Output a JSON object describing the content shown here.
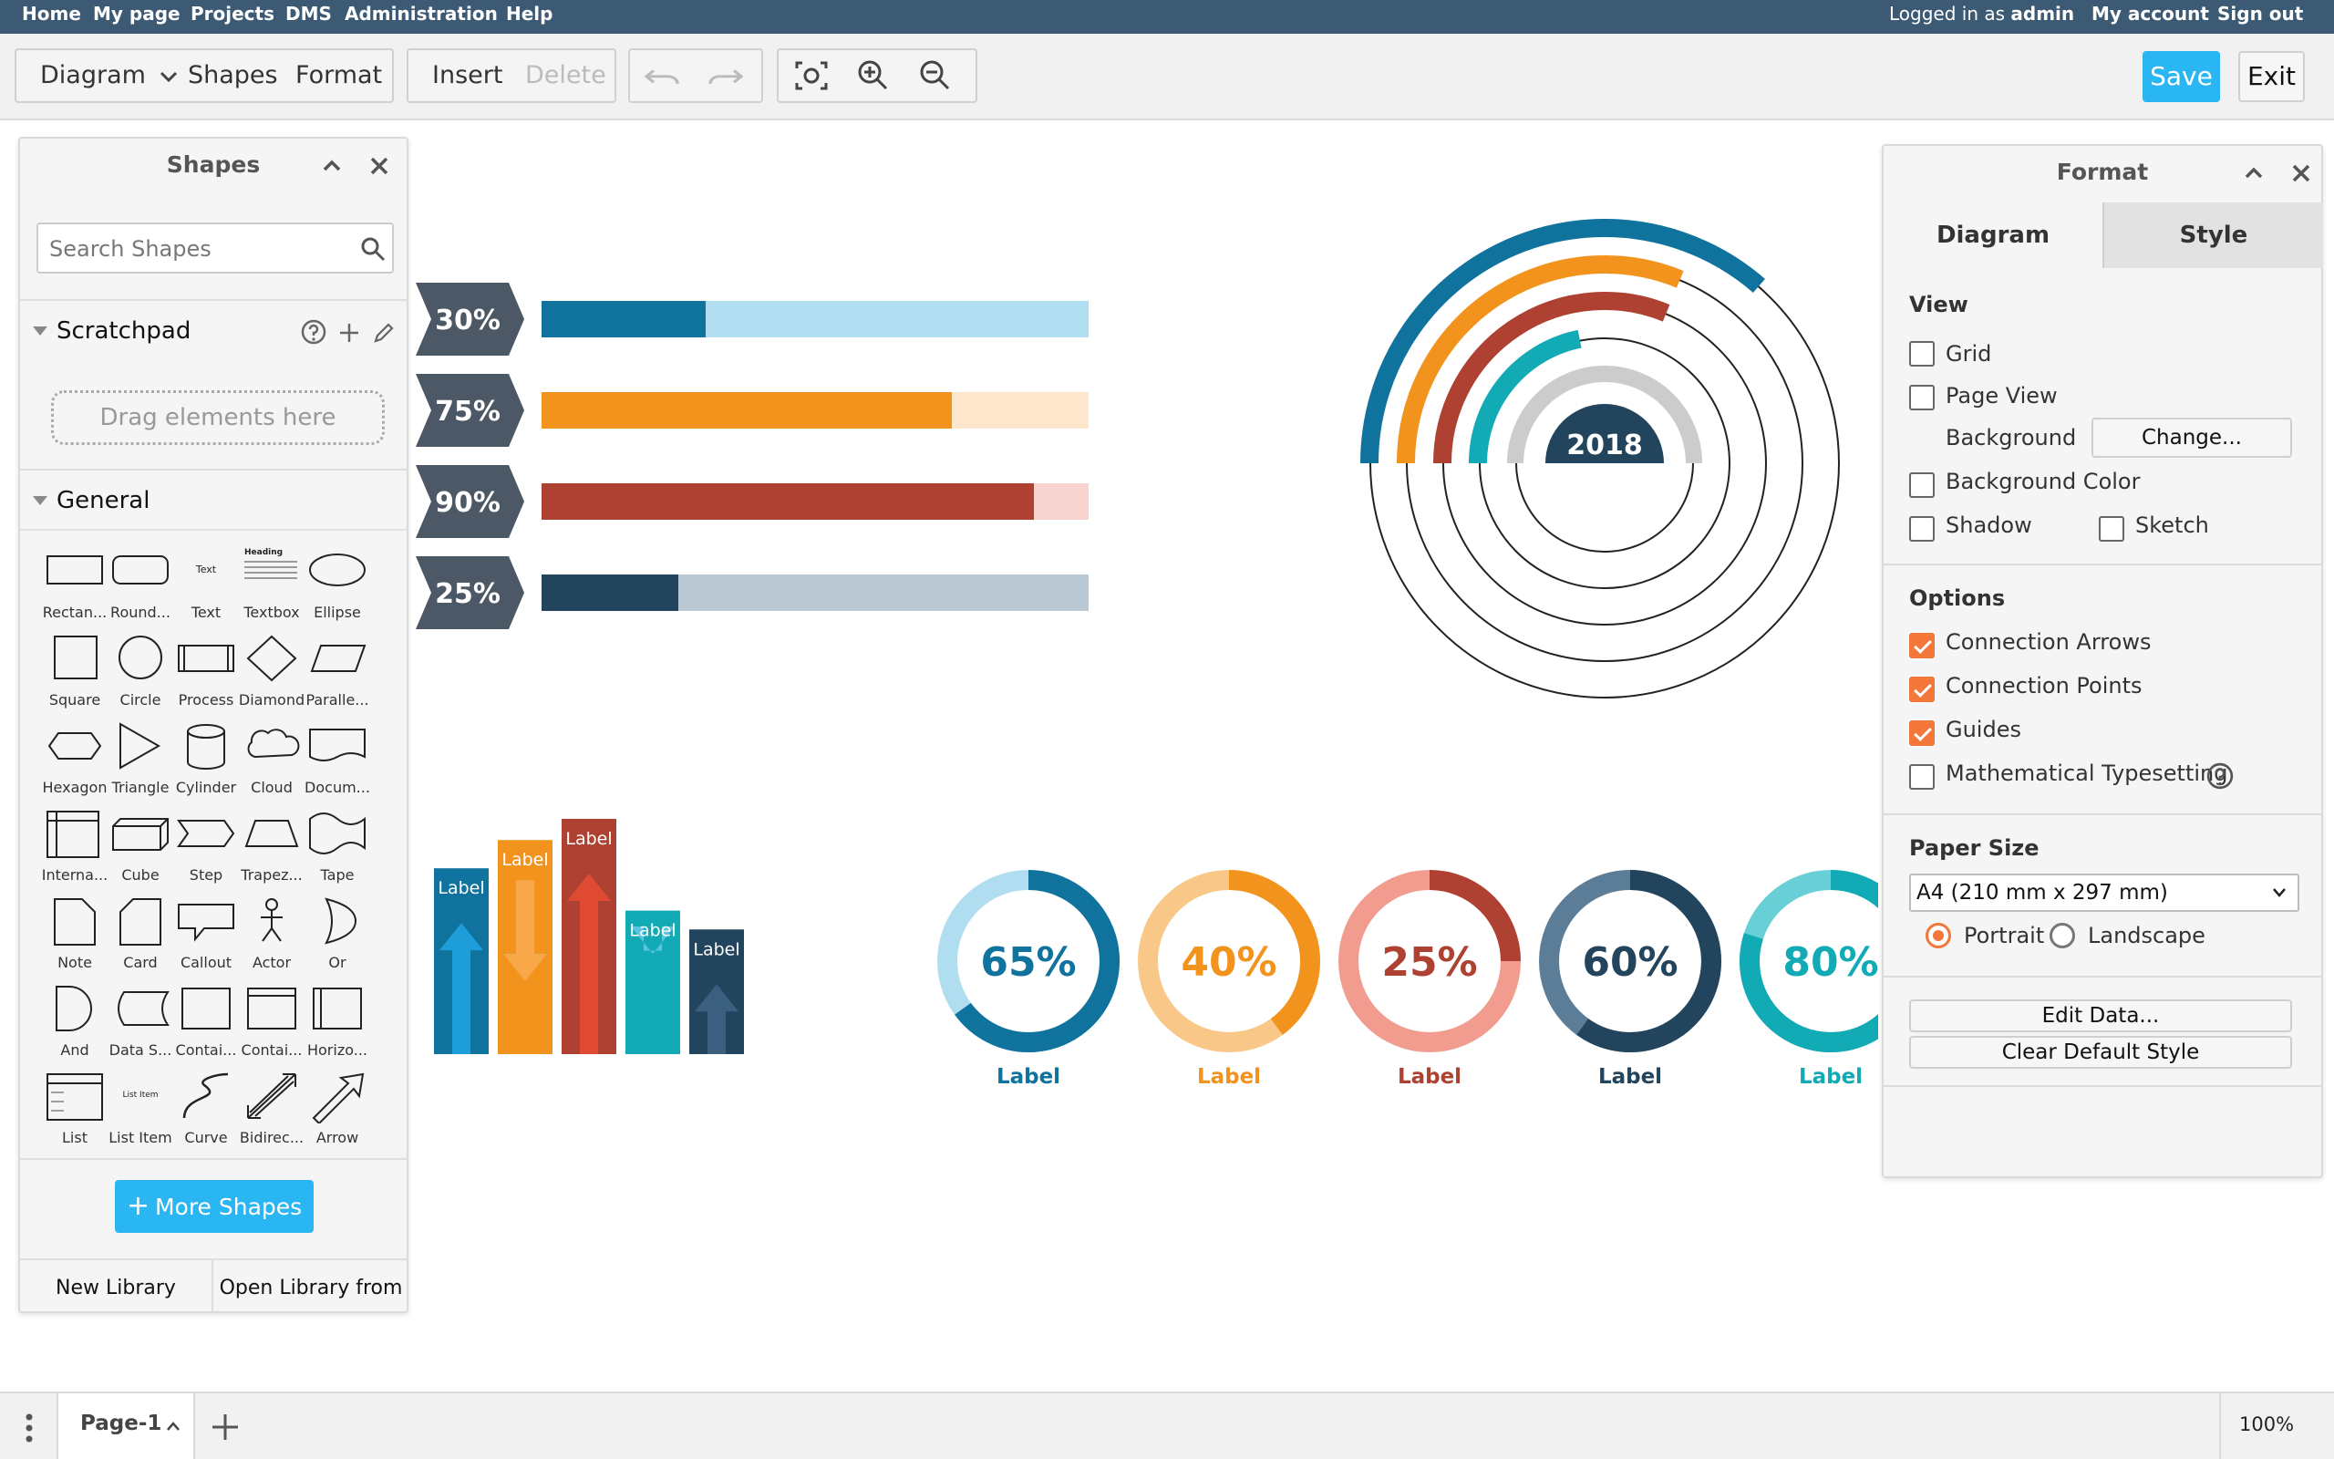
{
  "topnav": {
    "home": "Home",
    "my_page": "My page",
    "projects": "Projects",
    "dms": "DMS",
    "administration": "Administration",
    "help": "Help",
    "logged_in_prefix": "Logged in as",
    "user": "admin",
    "my_account": "My account",
    "sign_out": "Sign out"
  },
  "toolbar": {
    "diagram": "Diagram",
    "shapes": "Shapes",
    "format": "Format",
    "insert": "Insert",
    "delete": "Delete",
    "save": "Save",
    "exit": "Exit"
  },
  "shapes_panel": {
    "title": "Shapes",
    "search_placeholder": "Search Shapes",
    "scratchpad": "Scratchpad",
    "drop_hint": "Drag elements here",
    "general": "General",
    "items": [
      {
        "label": "Rectan...",
        "icon": "rectangle-shape-icon"
      },
      {
        "label": "Round...",
        "icon": "rounded-rectangle-shape-icon"
      },
      {
        "label": "Text",
        "icon": "text-shape-icon"
      },
      {
        "label": "Textbox",
        "icon": "textbox-shape-icon"
      },
      {
        "label": "Ellipse",
        "icon": "ellipse-shape-icon"
      },
      {
        "label": "Square",
        "icon": "square-shape-icon"
      },
      {
        "label": "Circle",
        "icon": "circle-shape-icon"
      },
      {
        "label": "Process",
        "icon": "process-shape-icon"
      },
      {
        "label": "Diamond",
        "icon": "diamond-shape-icon"
      },
      {
        "label": "Paralle...",
        "icon": "parallelogram-shape-icon"
      },
      {
        "label": "Hexagon",
        "icon": "hexagon-shape-icon"
      },
      {
        "label": "Triangle",
        "icon": "triangle-shape-icon"
      },
      {
        "label": "Cylinder",
        "icon": "cylinder-shape-icon"
      },
      {
        "label": "Cloud",
        "icon": "cloud-shape-icon"
      },
      {
        "label": "Docum...",
        "icon": "document-shape-icon"
      },
      {
        "label": "Interna...",
        "icon": "internal-storage-shape-icon"
      },
      {
        "label": "Cube",
        "icon": "cube-shape-icon"
      },
      {
        "label": "Step",
        "icon": "step-shape-icon"
      },
      {
        "label": "Trapez...",
        "icon": "trapezoid-shape-icon"
      },
      {
        "label": "Tape",
        "icon": "tape-shape-icon"
      },
      {
        "label": "Note",
        "icon": "note-shape-icon"
      },
      {
        "label": "Card",
        "icon": "card-shape-icon"
      },
      {
        "label": "Callout",
        "icon": "callout-shape-icon"
      },
      {
        "label": "Actor",
        "icon": "actor-shape-icon"
      },
      {
        "label": "Or",
        "icon": "or-shape-icon"
      },
      {
        "label": "And",
        "icon": "and-shape-icon"
      },
      {
        "label": "Data S...",
        "icon": "data-storage-shape-icon"
      },
      {
        "label": "Contai...",
        "icon": "container-shape-icon"
      },
      {
        "label": "Contai...",
        "icon": "container-titled-shape-icon"
      },
      {
        "label": "Horizo...",
        "icon": "horizontal-container-shape-icon"
      },
      {
        "label": "List",
        "icon": "list-shape-icon"
      },
      {
        "label": "List Item",
        "icon": "list-item-shape-icon"
      },
      {
        "label": "Curve",
        "icon": "curve-shape-icon"
      },
      {
        "label": "Bidirec...",
        "icon": "bidirectional-arrow-shape-icon"
      },
      {
        "label": "Arrow",
        "icon": "arrow-shape-icon"
      }
    ],
    "shape_text": {
      "text": "Text",
      "heading": "Heading",
      "list_item": "List Item"
    },
    "more_shapes": "More Shapes",
    "new_library": "New Library",
    "open_library": "Open Library from"
  },
  "format_panel": {
    "title": "Format",
    "tab_diagram": "Diagram",
    "tab_style": "Style",
    "view_title": "View",
    "grid": {
      "label": "Grid",
      "checked": false
    },
    "page_view": {
      "label": "Page View",
      "checked": false
    },
    "background_label": "Background",
    "change_button": "Change...",
    "background_color": {
      "label": "Background Color",
      "checked": false
    },
    "shadow": {
      "label": "Shadow",
      "checked": false
    },
    "sketch": {
      "label": "Sketch",
      "checked": false
    },
    "options_title": "Options",
    "connection_arrows": {
      "label": "Connection Arrows",
      "checked": true
    },
    "connection_points": {
      "label": "Connection Points",
      "checked": true
    },
    "guides": {
      "label": "Guides",
      "checked": true
    },
    "math_typesetting": {
      "label": "Mathematical Typesetting",
      "checked": false
    },
    "paper_size_title": "Paper Size",
    "paper_size_value": "A4 (210 mm x 297 mm)",
    "portrait": {
      "label": "Portrait",
      "selected": true
    },
    "landscape": {
      "label": "Landscape",
      "selected": false
    },
    "edit_data": "Edit Data...",
    "clear_default_style": "Clear Default Style"
  },
  "canvas": {
    "progress_bars": [
      {
        "label": "30%",
        "value": 0.3,
        "color": "#10739e",
        "track": "#b1ddf0",
        "tag": "#4d5866"
      },
      {
        "label": "75%",
        "value": 0.75,
        "color": "#f2931e",
        "track": "#fde6cc",
        "tag": "#4d5866"
      },
      {
        "label": "90%",
        "value": 0.9,
        "color": "#ae4132",
        "track": "#f8d4d0",
        "tag": "#4d5866"
      },
      {
        "label": "25%",
        "value": 0.25,
        "color": "#23445d",
        "track": "#bac8d3",
        "tag": "#4d5866"
      }
    ],
    "radial_center_label": "2018",
    "radial_arcs": [
      {
        "fraction": 0.7,
        "color": "#10739e"
      },
      {
        "fraction": 0.6,
        "color": "#f2931e"
      },
      {
        "fraction": 0.6,
        "color": "#ae4132"
      },
      {
        "fraction": 0.42,
        "color": "#12aab5"
      },
      {
        "fraction": 0.5,
        "color": "#cccccc"
      }
    ],
    "column_labels": [
      {
        "label": "Label",
        "height": 0.79,
        "color": "#10739e",
        "arrow": "up"
      },
      {
        "label": "Label",
        "height": 0.91,
        "color": "#f2931e",
        "arrow": "down"
      },
      {
        "label": "Label",
        "height": 1.0,
        "color": "#ae4132",
        "arrow": "up"
      },
      {
        "label": "Label",
        "height": 0.61,
        "color": "#12aab5",
        "arrow": "down"
      },
      {
        "label": "Label",
        "height": 0.53,
        "color": "#23445d",
        "arrow": "up"
      }
    ],
    "donuts": [
      {
        "value": "65%",
        "fraction": 0.65,
        "label": "Label",
        "color": "#10739e",
        "track": "#b1ddf0"
      },
      {
        "value": "40%",
        "fraction": 0.4,
        "label": "Label",
        "color": "#f2931e",
        "track": "#f9c889"
      },
      {
        "value": "25%",
        "fraction": 0.25,
        "label": "Label",
        "color": "#ae4132",
        "track": "#f19c8f"
      },
      {
        "value": "60%",
        "fraction": 0.6,
        "label": "Label",
        "color": "#23445d",
        "track": "#5c7d98"
      },
      {
        "value": "80%",
        "fraction": 0.8,
        "label": "Label",
        "color": "#12aab5",
        "track": "#67cfd5"
      }
    ]
  },
  "bottom": {
    "page_name": "Page-1",
    "zoom": "100%"
  }
}
